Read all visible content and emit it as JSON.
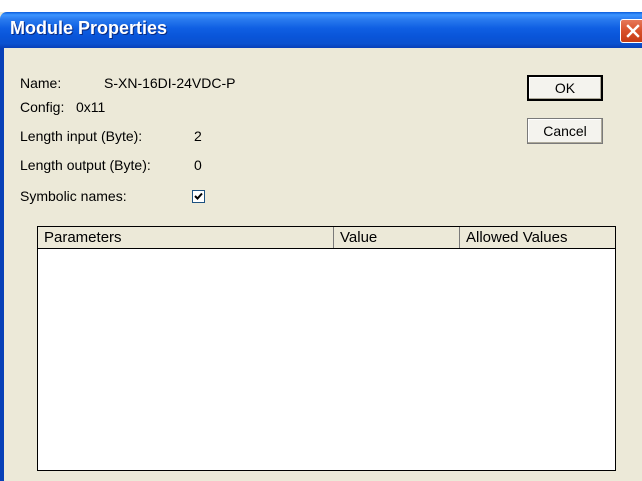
{
  "window": {
    "title": "Module Properties"
  },
  "fields": {
    "name_label": "Name:",
    "name_value": "S-XN-16DI-24VDC-P",
    "config_label": "Config:",
    "config_value": "0x11",
    "length_input_label": "Length input (Byte):",
    "length_input_value": "2",
    "length_output_label": "Length output (Byte):",
    "length_output_value": "0",
    "symbolic_names_label": "Symbolic names:",
    "symbolic_names_checked": true
  },
  "buttons": {
    "ok_label": "OK",
    "cancel_label": "Cancel"
  },
  "table": {
    "columns": [
      "Parameters",
      "Value",
      "Allowed Values"
    ],
    "rows": []
  },
  "colors": {
    "titlebar": "#0954d8",
    "dialog_face": "#ece9d8",
    "close_button": "#d8502a"
  },
  "icons": {
    "close": "close-icon",
    "checkmark": "checkmark-icon"
  }
}
